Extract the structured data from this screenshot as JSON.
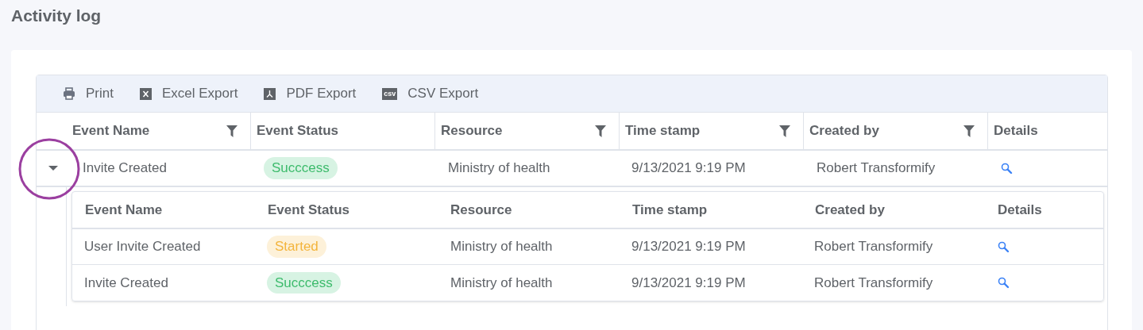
{
  "page_title": "Activity log",
  "toolbar": [
    {
      "kind": "print",
      "label": "Print"
    },
    {
      "kind": "excel",
      "label": "Excel Export"
    },
    {
      "kind": "pdf",
      "label": "PDF Export"
    },
    {
      "kind": "csv",
      "label": "CSV Export",
      "icon_text": "csv"
    }
  ],
  "table": {
    "columns": [
      {
        "label": "Event Name",
        "filterable": true
      },
      {
        "label": "Event Status",
        "filterable": false
      },
      {
        "label": "Resource",
        "filterable": true
      },
      {
        "label": "Time stamp",
        "filterable": true
      },
      {
        "label": "Created by",
        "filterable": true
      },
      {
        "label": "Details",
        "filterable": false
      }
    ],
    "rows": [
      {
        "event_name": "Invite Created",
        "status": {
          "label": "Succcess",
          "kind": "success"
        },
        "resource": "Ministry of health",
        "time_stamp": "9/13/2021 9:19 PM",
        "created_by": "Robert Transformify",
        "expanded": true,
        "highlighted": true,
        "detail": {
          "columns": [
            "Event Name",
            "Event Status",
            "Resource",
            "Time stamp",
            "Created by",
            "Details"
          ],
          "rows": [
            {
              "event_name": "User Invite Created",
              "status": {
                "label": "Started",
                "kind": "started"
              },
              "resource": "Ministry of health",
              "time_stamp": "9/13/2021 9:19 PM",
              "created_by": "Robert Transformify"
            },
            {
              "event_name": "Invite Created",
              "status": {
                "label": "Succcess",
                "kind": "success"
              },
              "resource": "Ministry of health",
              "time_stamp": "9/13/2021 9:19 PM",
              "created_by": "Robert Transformify"
            }
          ]
        }
      }
    ]
  }
}
